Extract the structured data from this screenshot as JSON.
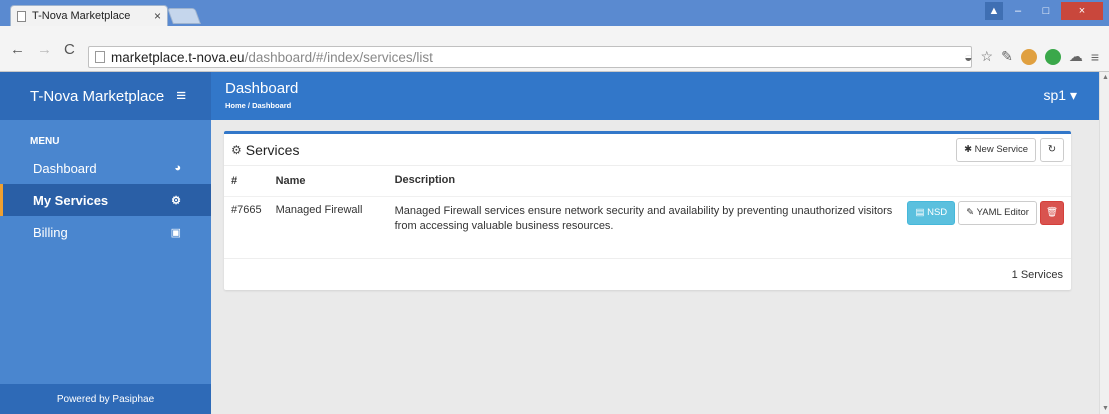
{
  "browser": {
    "tab_title": "T-Nova Marketplace",
    "tab_close": "×",
    "url_host": "marketplace.t-nova.eu",
    "url_path": "/dashboard/#/index/services/list",
    "window_controls": {
      "user": "▲",
      "minimize": "–",
      "maximize": "□",
      "close": "×"
    },
    "extension_icons": [
      "rss-icon",
      "star-icon",
      "pen-icon",
      "cookie-icon",
      "new-badge-icon",
      "cloud-icon",
      "menu-icon"
    ]
  },
  "app": {
    "brand": "T-Nova Marketplace",
    "menu_label": "MENU",
    "sidebar": {
      "items": [
        {
          "label": "Dashboard",
          "icon": "dashboard-icon",
          "glyph": "◕"
        },
        {
          "label": "My Services",
          "icon": "gears-icon",
          "glyph": "⚙",
          "active": true
        },
        {
          "label": "Billing",
          "icon": "money-icon",
          "glyph": "▣"
        }
      ],
      "footer": "Powered by Pasiphae"
    },
    "header": {
      "title": "Dashboard",
      "breadcrumb": "Home / Dashboard",
      "user": "sp1 ▾"
    },
    "panel": {
      "title": "Services",
      "new_button": "✱ New Service",
      "refresh_glyph": "↻",
      "columns": [
        "#",
        "Name",
        "Description"
      ],
      "rows": [
        {
          "id": "#7665",
          "name": "Managed Firewall",
          "description": "Managed Firewall services ensure network security and availability by preventing unauthorized visitors from accessing valuable business resources.",
          "nsd_label": "▤ NSD",
          "yaml_label": "✎ YAML Editor",
          "delete_glyph": "🗑"
        }
      ],
      "footer": "1 Services"
    }
  },
  "colors": {
    "sidebar": "#4a86cf",
    "brand_bar": "#2e6ab7",
    "header": "#3277c9",
    "active_accent": "#f0a030",
    "nsd": "#5bc0de",
    "delete": "#d9534f"
  }
}
